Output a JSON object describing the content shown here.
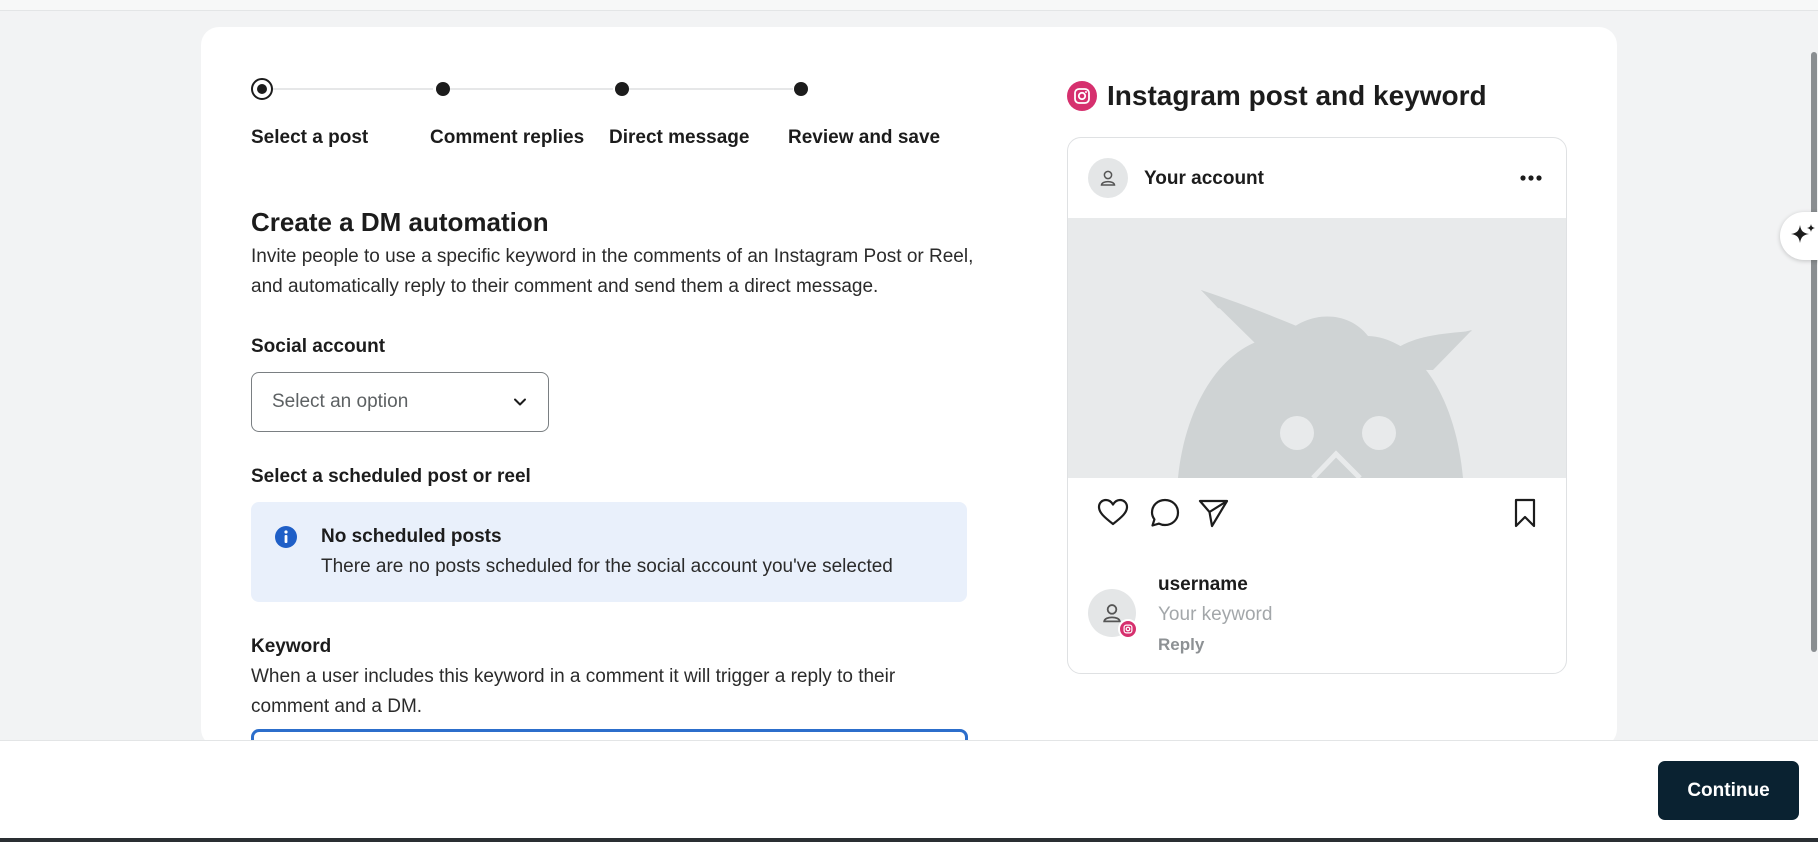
{
  "stepper": {
    "steps": [
      {
        "label": "Select a post",
        "active": true
      },
      {
        "label": "Comment replies",
        "active": false
      },
      {
        "label": "Direct message",
        "active": false
      },
      {
        "label": "Review and save",
        "active": false
      }
    ]
  },
  "form": {
    "title": "Create a DM automation",
    "intro": "Invite people to use a specific keyword in the comments of an Instagram Post or Reel, and automatically reply to their comment and send them a direct message.",
    "social_account_label": "Social account",
    "social_account_placeholder": "Select an option",
    "scheduled_label": "Select a scheduled post or reel",
    "info_title": "No scheduled posts",
    "info_text": "There are no posts scheduled for the social account you've selected",
    "keyword_label": "Keyword",
    "keyword_desc": "When a user includes this keyword in a comment it will trigger a reply to their comment and a DM."
  },
  "preview": {
    "title": "Instagram post and keyword",
    "account": "Your account",
    "username": "username",
    "keyword": "Your keyword",
    "reply": "Reply"
  },
  "footer": {
    "continue_label": "Continue"
  },
  "colors": {
    "accent": "#0a2231",
    "instagram": "#d6306e",
    "info_bg": "#e9f0fb",
    "focus": "#2c6ecb"
  }
}
